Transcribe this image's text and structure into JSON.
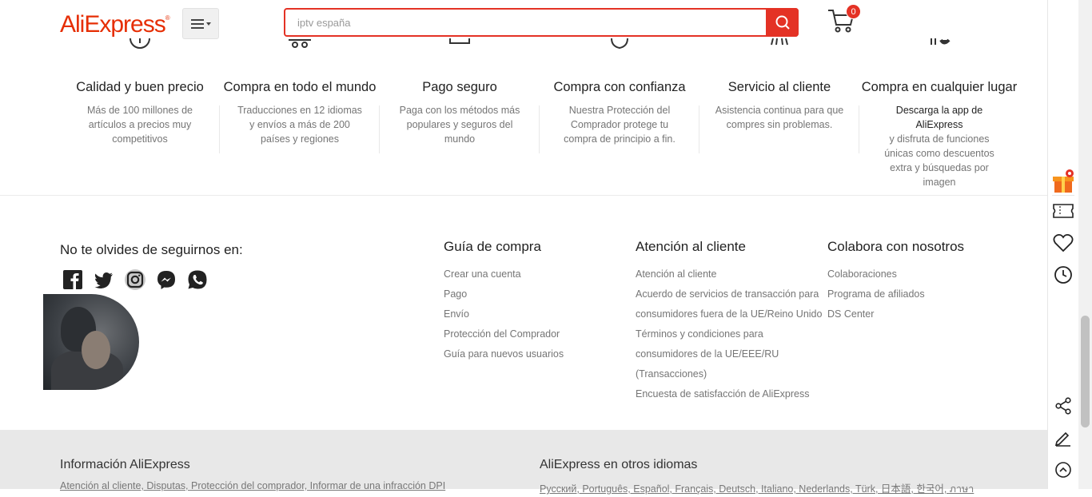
{
  "header": {
    "logo": "AliExpress",
    "search_value": "iptv españa",
    "cart_count": "0"
  },
  "benefits": [
    {
      "title": "Calidad y buen precio",
      "text": "Más de 100 millones de artículos a precios muy competitivos"
    },
    {
      "title": "Compra en todo el mundo",
      "text": "Traducciones en 12 idiomas y envíos a más de 200 países y regiones"
    },
    {
      "title": "Pago seguro",
      "text": "Paga con los métodos más populares y seguros del mundo"
    },
    {
      "title": "Compra con confianza",
      "text": "Nuestra Protección del Comprador protege tu compra de principio a fin."
    },
    {
      "title": "Servicio al cliente",
      "text": "Asistencia continua para que compres sin problemas."
    },
    {
      "title": "Compra en cualquier lugar",
      "text_dark": "Descarga la app de AliExpress",
      "text": "y disfruta de funciones únicas como descuentos extra y búsquedas por imagen"
    }
  ],
  "follow": {
    "title": "No te olvides de seguirnos en:",
    "icons": [
      "facebook-icon",
      "twitter-icon",
      "instagram-icon",
      "messenger-icon",
      "whatsapp-icon"
    ]
  },
  "columns": [
    {
      "title": "Guía de compra",
      "links": [
        "Crear una cuenta",
        "Pago",
        "Envío",
        "Protección del Comprador",
        "Guía para nuevos usuarios"
      ]
    },
    {
      "title": "Atención al cliente",
      "links": [
        "Atención al cliente",
        "Acuerdo de servicios de transacción para",
        "consumidores fuera de la UE/Reino Unido",
        "Términos y condiciones para",
        "consumidores de la UE/EEE/RU",
        "(Transacciones)",
        "Encuesta de satisfacción de AliExpress"
      ]
    },
    {
      "title": "Colabora con nosotros",
      "links": [
        "Colaboraciones",
        "Programa de afiliados",
        "DS Center"
      ]
    }
  ],
  "bottom": {
    "info_title": "Información AliExpress",
    "info_links": "Atención al cliente, Disputas, Protección del comprador, Informar de una infracción DPI",
    "langs_title": "AliExpress en otros idiomas",
    "langs_links": "Русский, Português, Español, Français, Deutsch, Italiano, Nederlands, Türk, 日本語, 한국어, ภาษา"
  },
  "colors": {
    "brand": "#e62e04",
    "search_border": "#e43225"
  }
}
